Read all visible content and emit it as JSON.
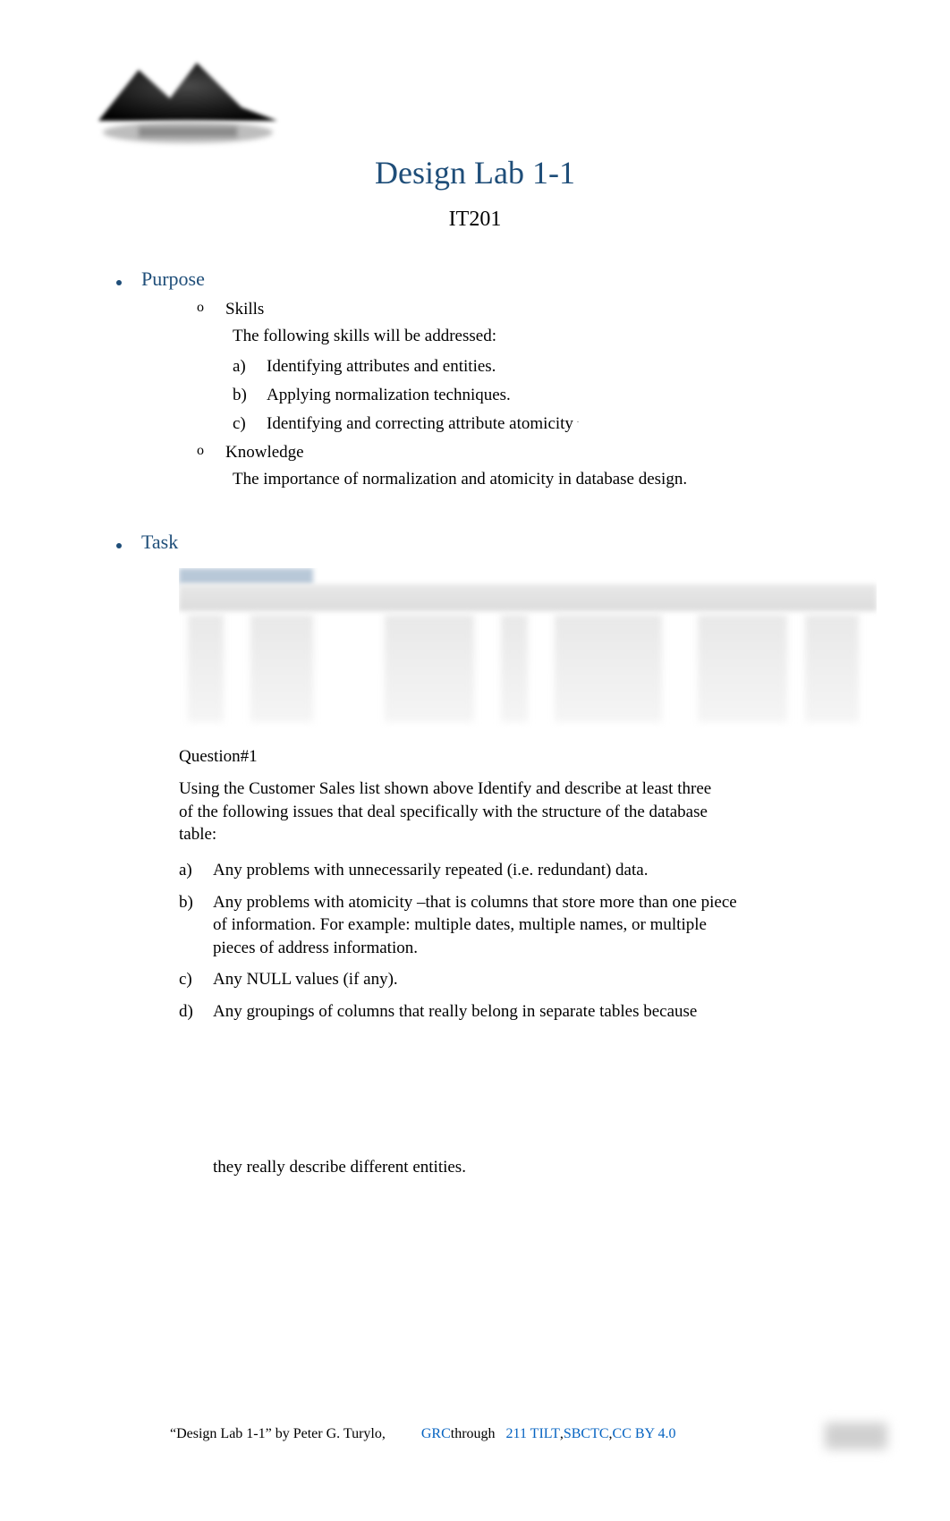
{
  "title": "Design Lab 1-1",
  "course": "IT201",
  "sections": {
    "purpose": {
      "heading": "Purpose",
      "skills_label": "Skills",
      "skills_intro": "The following skills will be addressed:",
      "skills_items": {
        "a": {
          "marker": "a)",
          "text": "Identifying attributes and entities."
        },
        "b": {
          "marker": "b)",
          "text": "Applying normalization techniques."
        },
        "c": {
          "marker": "c)",
          "text": "Identifying and correcting attribute atomicity"
        }
      },
      "knowledge_label": "Knowledge",
      "knowledge_text": "The importance of normalization and atomicity in database design."
    },
    "task": {
      "heading": "Task",
      "question_label": "Question#1",
      "question_para": "Using the Customer Sales list shown above Identify and describe at least three of the following issues that deal specifically with the structure of the database table:",
      "items": {
        "a": {
          "marker": "a)",
          "text": "Any problems with unnecessarily repeated (i.e. redundant) data."
        },
        "b": {
          "marker": "b)",
          "text": "Any problems with atomicity –that is columns that store more than one piece of information. For example: multiple dates, multiple names, or multiple pieces of address information."
        },
        "c": {
          "marker": "c)",
          "text": "Any NULL values (if any)."
        },
        "d": {
          "marker": "d)",
          "text": "Any groupings of columns that really belong in separate tables because"
        }
      },
      "tail": "they really describe different entities."
    }
  },
  "sublist_marker": "o",
  "footer": {
    "prefix": "“Design Lab 1-1” by Peter G. Turylo,",
    "links": {
      "grc": "GRC",
      "through": " through ",
      "tilt": "211 TILT",
      "sbctc": "SBCTC",
      "cc": "CC BY 4.0"
    },
    "sep1": " , ",
    "sep2": ", "
  }
}
